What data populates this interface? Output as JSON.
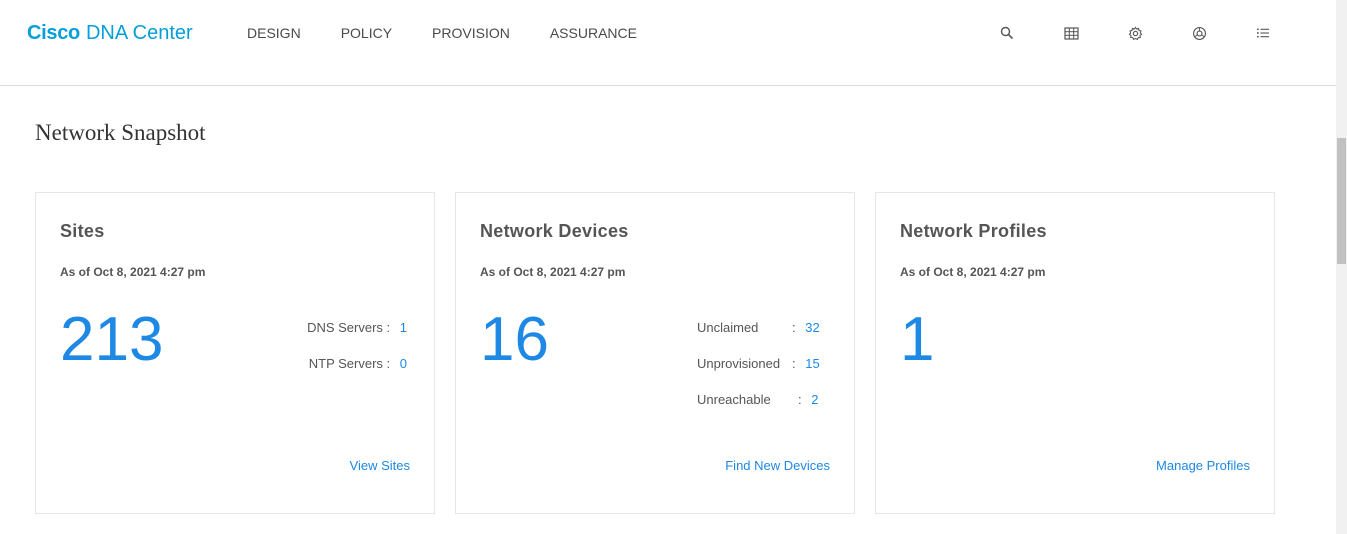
{
  "header": {
    "brand_cisco": "Cisco",
    "brand_product": "DNA Center",
    "nav": [
      "DESIGN",
      "POLICY",
      "PROVISION",
      "ASSURANCE"
    ],
    "icons": [
      "search-icon",
      "grid-icon",
      "gear-icon",
      "help-circle-icon",
      "list-icon"
    ]
  },
  "page": {
    "title": "Network Snapshot"
  },
  "cards": {
    "sites": {
      "title": "Sites",
      "date": "As of Oct 8, 2021 4:27 pm",
      "count": "213",
      "stats": [
        {
          "label": "DNS Servers :",
          "value": "1"
        },
        {
          "label": "NTP Servers :",
          "value": "0"
        }
      ],
      "link": "View Sites"
    },
    "devices": {
      "title": "Network Devices",
      "date": "As of Oct 8, 2021 4:27 pm",
      "count": "16",
      "stats": [
        {
          "label": "Unclaimed",
          "sep": ":",
          "value": "32"
        },
        {
          "label": "Unprovisioned",
          "sep": ":",
          "value": "15"
        },
        {
          "label": "Unreachable",
          "sep": ":",
          "value": "2"
        }
      ],
      "link": "Find New Devices"
    },
    "profiles": {
      "title": "Network Profiles",
      "date": "As of Oct 8, 2021 4:27 pm",
      "count": "1",
      "link": "Manage Profiles"
    }
  },
  "colors": {
    "brand": "#049fd9",
    "accent": "#1e88e5",
    "text": "#4a4a4a"
  }
}
